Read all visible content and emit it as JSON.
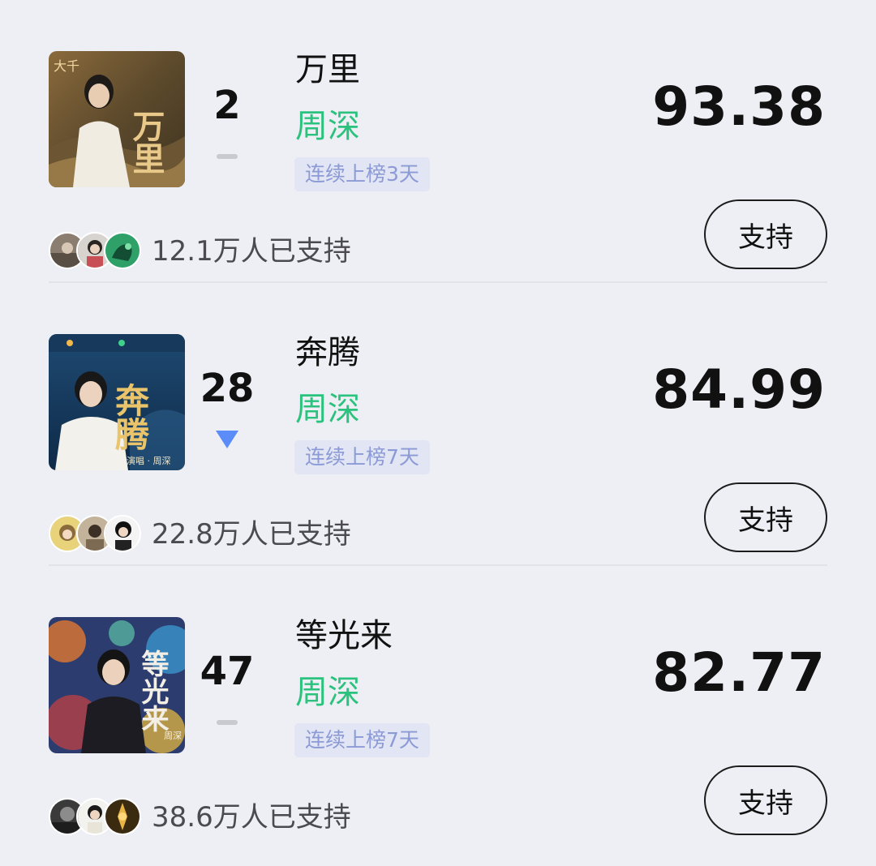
{
  "items": [
    {
      "rank": "2",
      "trend": "flat",
      "title": "万里",
      "artist": "周深",
      "badge": "连续上榜3天",
      "score": "93.38",
      "supporters": "12.1万人已支持",
      "support_label": "支持",
      "cover_text": "万里",
      "cover_small_text": "大千"
    },
    {
      "rank": "28",
      "trend": "down",
      "title": "奔腾",
      "artist": "周深",
      "badge": "连续上榜7天",
      "score": "84.99",
      "supporters": "22.8万人已支持",
      "support_label": "支持",
      "cover_text": "奔腾",
      "cover_small_text": "演唱 · 周深"
    },
    {
      "rank": "47",
      "trend": "flat",
      "title": "等光来",
      "artist": "周深",
      "badge": "连续上榜7天",
      "score": "82.77",
      "supporters": "38.6万人已支持",
      "support_label": "支持",
      "cover_text": "等光来",
      "cover_small_text": "周深"
    }
  ],
  "colors": {
    "background": "#eeeff4",
    "artist": "#2bc27e",
    "badge_bg": "#e1e5f4",
    "badge_text": "#8c9ad6",
    "trend_down": "#5b8cf7",
    "trend_flat": "#c9cad0"
  }
}
